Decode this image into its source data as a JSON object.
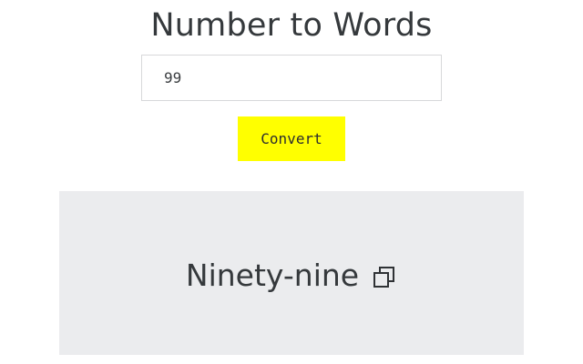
{
  "app": {
    "title": "Number to Words"
  },
  "form": {
    "input_value": "99",
    "convert_label": "Convert"
  },
  "result": {
    "text": "Ninety-nine",
    "copy_icon": "copy-icon"
  },
  "colors": {
    "accent_button": "#ffff00",
    "result_background": "#ebecee",
    "text": "#35393c"
  }
}
